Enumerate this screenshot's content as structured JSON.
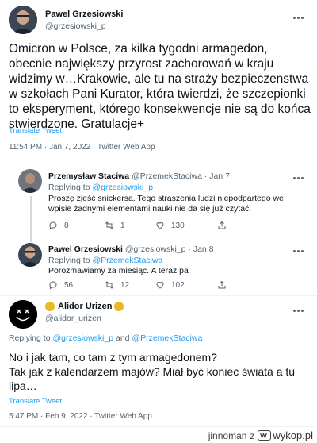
{
  "tweet1": {
    "name": "Pawel Grzesiowski",
    "handle": "@grzesiowski_p",
    "text": "Omicron w Polsce, za kilka tygodni armagedon, obecnie największy przyrost zachorowań w kraju widzimy w…Krakowie, ale tu na straży bezpieczenstwa w szkołach Pani Kurator, która twierdzi, że szczepionki to eksperyment, którego konsekwencje nie są do końca stwierdzone. Gratulacje+",
    "translate": "Translate Tweet",
    "meta": "11:54 PM · Jan 7, 2022 · Twitter Web App"
  },
  "reply1": {
    "name": "Przemysław Staciwa",
    "handle_date": "@PrzemekStaciwa · Jan 7",
    "replying_prefix": "Replying to",
    "replying_to": "@grzesiowski_p",
    "text": "Proszę zjeść snickersa. Tego straszenia ludzi niepodpartego we wpisie żadnymi elementami nauki nie da się już czytać.",
    "replies": "8",
    "retweets": "1",
    "likes": "130"
  },
  "reply2": {
    "name": "Pawel Grzesiowski",
    "handle_date": "@grzesiowski_p · Jan 8",
    "replying_prefix": "Replying to",
    "replying_to": "@PrzemekStaciwa",
    "text": "Porozmawiamy za miesiąc. A teraz pa",
    "replies": "56",
    "retweets": "12",
    "likes": "102"
  },
  "tweet2": {
    "name": "Alidor Urizen",
    "handle": "@alidor_urizen",
    "replying_prefix": "Replying to",
    "replying_to_1": "@grzesiowski_p",
    "replying_and": "and",
    "replying_to_2": "@PrzemekStaciwa",
    "text_line1": "No i jak tam, co tam z tym armagedonem?",
    "text_line2": "Tak jak z kalendarzem majów? Miał być koniec świata a tu lipa…",
    "translate": "Translate Tweet",
    "meta": "5:47 PM · Feb 9, 2022 · Twitter Web App"
  },
  "watermark": {
    "user": "jinnoman",
    "z": "z",
    "site": "wykop.pl"
  },
  "colors": {
    "accent": "#1d9bf0",
    "text": "#0f1419",
    "muted": "#536471",
    "badge": "#e8b923"
  }
}
